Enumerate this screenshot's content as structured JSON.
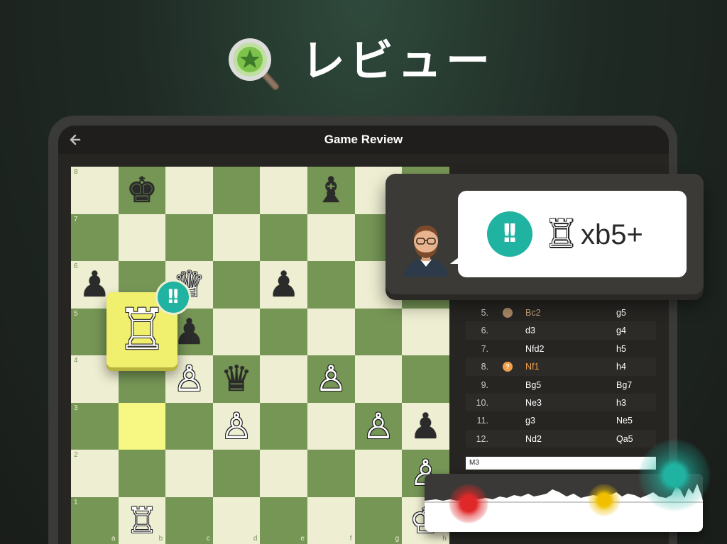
{
  "hero": {
    "title": "レビュー",
    "icon": "magnifier-star-icon"
  },
  "topbar": {
    "title": "Game Review",
    "back_icon": "back-arrow-icon"
  },
  "board": {
    "ranks": [
      "8",
      "7",
      "6",
      "5",
      "4",
      "3",
      "2",
      "1"
    ],
    "files": [
      "a",
      "b",
      "c",
      "d",
      "e",
      "f",
      "g",
      "h"
    ],
    "highlighted_squares": [
      "b3",
      "b5"
    ],
    "pieces": [
      {
        "sq": "b8",
        "glyph": "♚",
        "color": "b"
      },
      {
        "sq": "f8",
        "glyph": "♝",
        "color": "b"
      },
      {
        "sq": "a6",
        "glyph": "♟",
        "color": "b"
      },
      {
        "sq": "c6",
        "glyph": "♕",
        "color": "w"
      },
      {
        "sq": "e6",
        "glyph": "♟",
        "color": "b"
      },
      {
        "sq": "c5",
        "glyph": "♟",
        "color": "b"
      },
      {
        "sq": "c4",
        "glyph": "♙",
        "color": "w"
      },
      {
        "sq": "d4",
        "glyph": "♛",
        "color": "b"
      },
      {
        "sq": "f4",
        "glyph": "♙",
        "color": "w"
      },
      {
        "sq": "d3",
        "glyph": "♙",
        "color": "w"
      },
      {
        "sq": "g3",
        "glyph": "♙",
        "color": "w"
      },
      {
        "sq": "h3",
        "glyph": "♟",
        "color": "b"
      },
      {
        "sq": "h2",
        "glyph": "♙",
        "color": "w"
      },
      {
        "sq": "b1",
        "glyph": "♖",
        "color": "w"
      },
      {
        "sq": "h1",
        "glyph": "♔",
        "color": "w"
      }
    ],
    "lifted_piece": {
      "glyph": "♖",
      "color": "w"
    },
    "badge": "!!"
  },
  "coach": {
    "badge": "!!",
    "piece_glyph": "♖",
    "move": "xb5+",
    "avatar_icon": "coach-avatar-icon"
  },
  "moves": [
    {
      "num": "5.",
      "white": "Bc2",
      "black": "g5",
      "icon": "book",
      "white_color": "#c8a27a"
    },
    {
      "num": "6.",
      "white": "d3",
      "black": "g4",
      "icon": "",
      "white_color": "#ffffff"
    },
    {
      "num": "7.",
      "white": "Nfd2",
      "black": "h5",
      "icon": "",
      "white_color": "#ffffff"
    },
    {
      "num": "8.",
      "white": "Nf1",
      "black": "h4",
      "icon": "inaccuracy",
      "white_color": "#f0a04b"
    },
    {
      "num": "9.",
      "white": "Bg5",
      "black": "Bg7",
      "icon": "",
      "white_color": "#ffffff"
    },
    {
      "num": "10.",
      "white": "Ne3",
      "black": "h3",
      "icon": "",
      "white_color": "#ffffff"
    },
    {
      "num": "11.",
      "white": "g3",
      "black": "Ne5",
      "icon": "",
      "white_color": "#ffffff"
    },
    {
      "num": "12.",
      "white": "Nd2",
      "black": "Qa5",
      "icon": "",
      "white_color": "#ffffff"
    }
  ],
  "eval": {
    "label": "M3"
  },
  "colors": {
    "light_square": "#eeeed2",
    "dark_square": "#769656",
    "highlight": "#f7f783",
    "brilliant": "#20b3a1",
    "blunder": "#e02828",
    "inaccuracy": "#f0c000",
    "best": "#20b3a1"
  }
}
